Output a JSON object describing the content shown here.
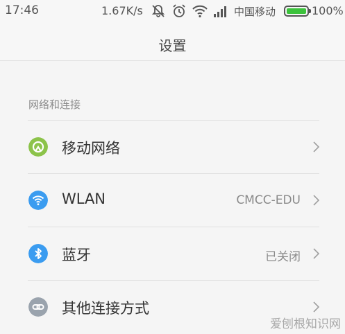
{
  "status_bar": {
    "time": "17:46",
    "net_speed": "1.67K/s",
    "carrier": "中国移动",
    "battery_percent": "100%",
    "battery_level": 1.0
  },
  "header": {
    "title": "设置"
  },
  "section": {
    "title": "网络和连接"
  },
  "items": [
    {
      "label": "移动网络",
      "value": "",
      "icon": "mobile-network-icon",
      "color": "#8cc34a"
    },
    {
      "label": "WLAN",
      "value": "CMCC-EDU",
      "icon": "wifi-icon",
      "color": "#3b9cf0"
    },
    {
      "label": "蓝牙",
      "value": "已关闭",
      "icon": "bluetooth-icon",
      "color": "#3b9cf0"
    },
    {
      "label": "其他连接方式",
      "value": "",
      "icon": "link-icon",
      "color": "#9aa3ad"
    }
  ],
  "watermark": "爱刨根知识网"
}
